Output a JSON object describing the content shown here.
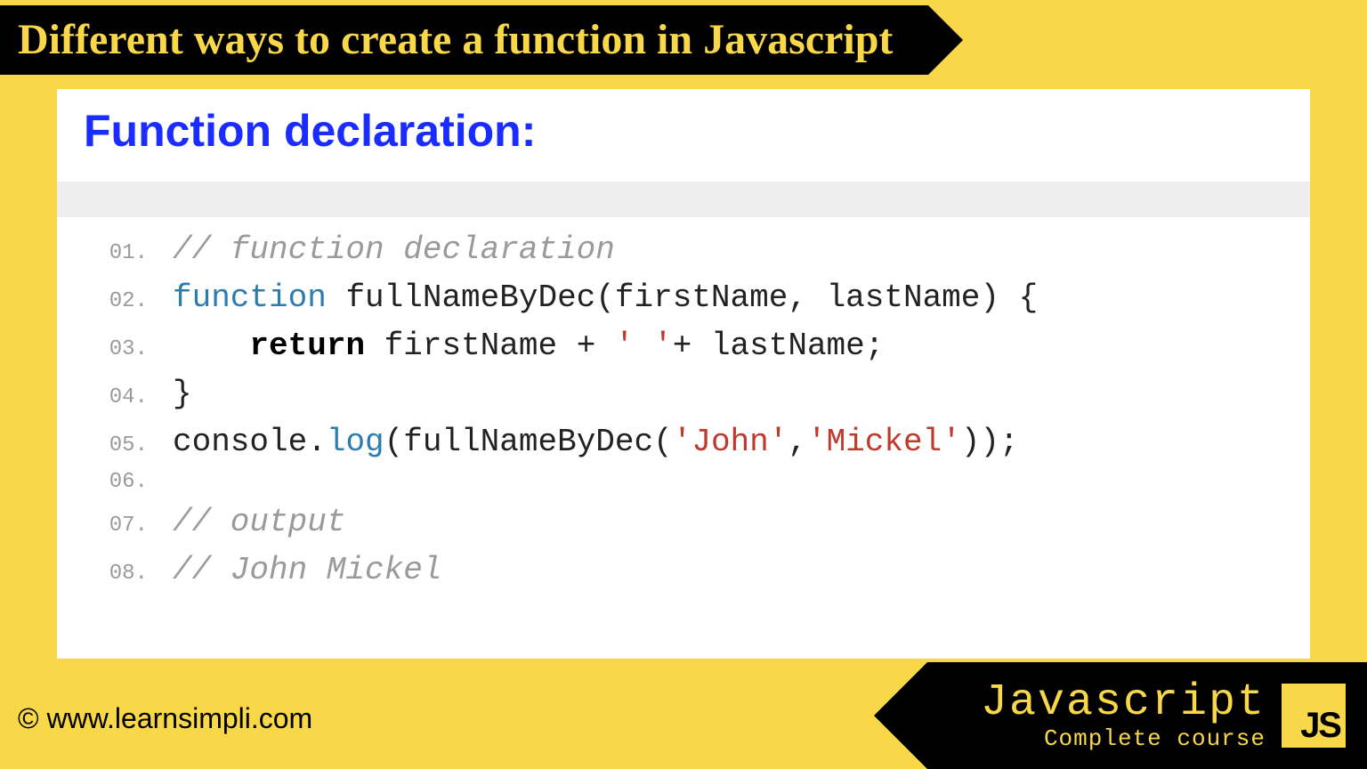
{
  "header": {
    "title": "Different ways to create a function in Javascript"
  },
  "section": {
    "title": "Function declaration:"
  },
  "code": {
    "lines": [
      {
        "n": "01.",
        "tokens": [
          {
            "cls": "cm",
            "t": "// function declaration"
          }
        ]
      },
      {
        "n": "02.",
        "tokens": [
          {
            "cls": "kw1",
            "t": "function"
          },
          {
            "cls": "p",
            "t": " "
          },
          {
            "cls": "id",
            "t": "fullNameByDec"
          },
          {
            "cls": "p",
            "t": "("
          },
          {
            "cls": "id",
            "t": "firstName"
          },
          {
            "cls": "p",
            "t": ", "
          },
          {
            "cls": "id",
            "t": "lastName"
          },
          {
            "cls": "p",
            "t": ") {"
          }
        ]
      },
      {
        "n": "03.",
        "tokens": [
          {
            "cls": "p",
            "t": "    "
          },
          {
            "cls": "kw2",
            "t": "return"
          },
          {
            "cls": "p",
            "t": " "
          },
          {
            "cls": "id",
            "t": "firstName"
          },
          {
            "cls": "p",
            "t": " + "
          },
          {
            "cls": "str",
            "t": "' '"
          },
          {
            "cls": "p",
            "t": "+ "
          },
          {
            "cls": "id",
            "t": "lastName"
          },
          {
            "cls": "p",
            "t": ";"
          }
        ]
      },
      {
        "n": "04.",
        "tokens": [
          {
            "cls": "p",
            "t": "}"
          }
        ]
      },
      {
        "n": "05.",
        "tokens": [
          {
            "cls": "id",
            "t": "console"
          },
          {
            "cls": "p",
            "t": "."
          },
          {
            "cls": "fn",
            "t": "log"
          },
          {
            "cls": "p",
            "t": "("
          },
          {
            "cls": "id",
            "t": "fullNameByDec"
          },
          {
            "cls": "p",
            "t": "("
          },
          {
            "cls": "str",
            "t": "'John'"
          },
          {
            "cls": "p",
            "t": ","
          },
          {
            "cls": "str",
            "t": "'Mickel'"
          },
          {
            "cls": "p",
            "t": "));"
          }
        ]
      },
      {
        "n": "06.",
        "tokens": [
          {
            "cls": "p",
            "t": ""
          }
        ]
      },
      {
        "n": "07.",
        "tokens": [
          {
            "cls": "cm",
            "t": "// output"
          }
        ]
      },
      {
        "n": "08.",
        "tokens": [
          {
            "cls": "cm",
            "t": "// John Mickel"
          }
        ]
      }
    ]
  },
  "footer": {
    "copyright": "© www.learnsimpli.com",
    "brand_title": "Javascript",
    "brand_sub": "Complete course",
    "badge_text": "JS"
  }
}
